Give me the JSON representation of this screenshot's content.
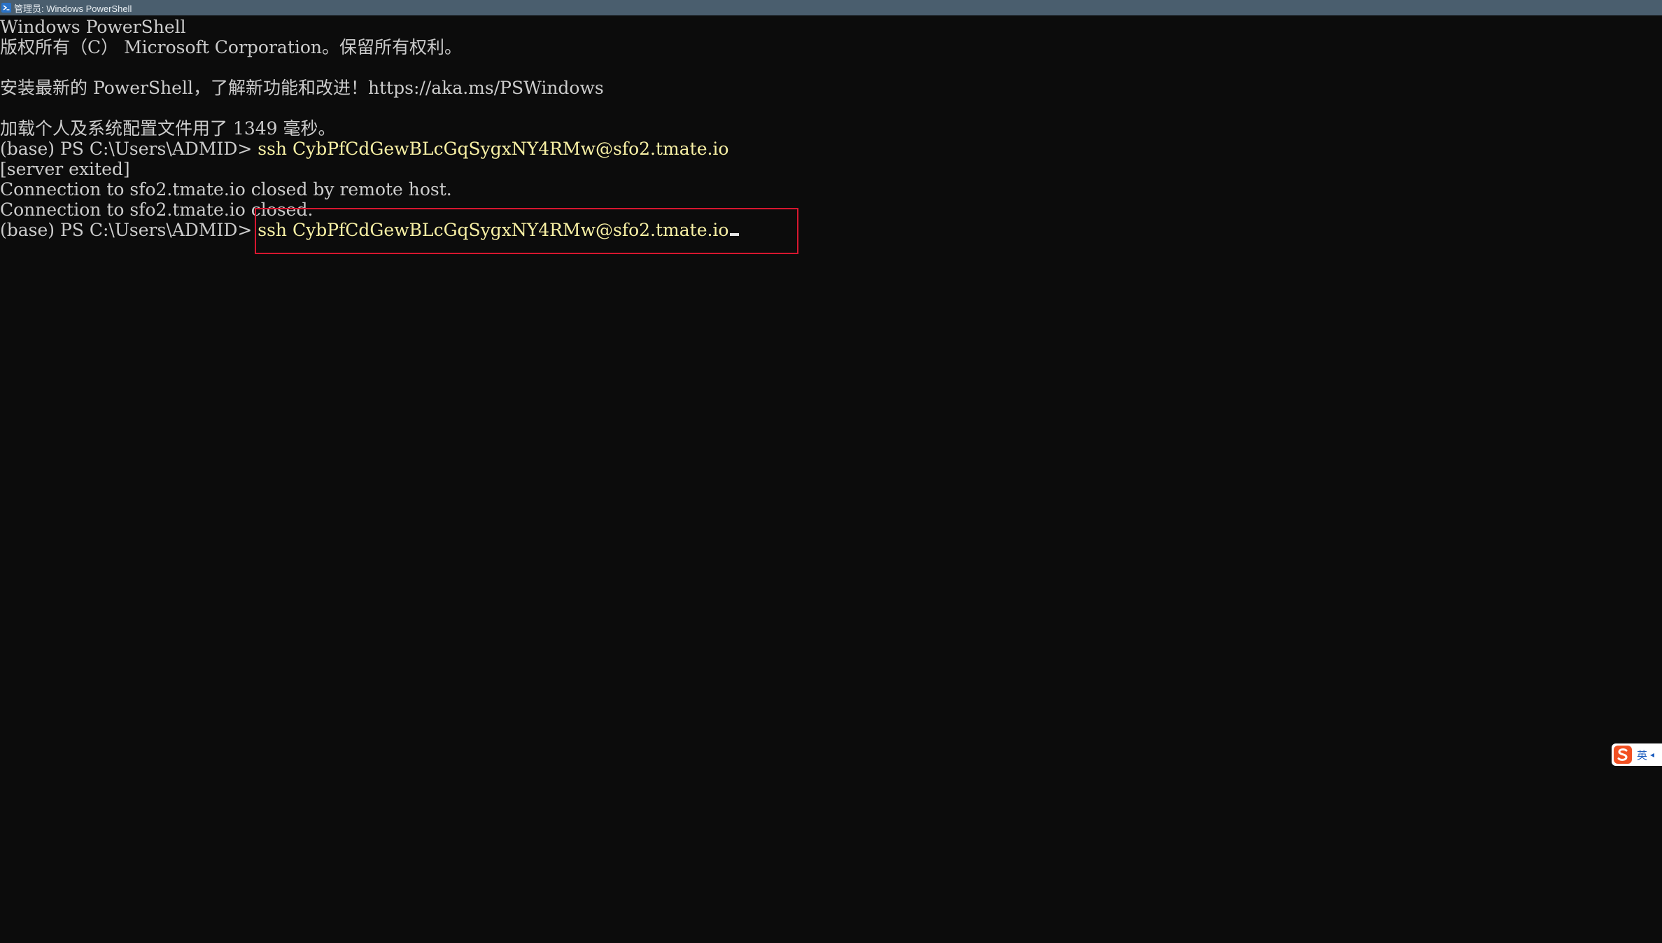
{
  "window": {
    "title": "管理员: Windows PowerShell"
  },
  "terminal": {
    "lines": [
      "Windows PowerShell",
      "版权所有（C） Microsoft Corporation。保留所有权利。",
      "",
      "安装最新的 PowerShell，了解新功能和改进！https://aka.ms/PSWindows",
      "",
      "加载个人及系统配置文件用了 1349 毫秒。"
    ],
    "prompt1": "(base) PS C:\\Users\\ADMID> ",
    "command1": "ssh CybPfCdGewBLcGqSygxNY4RMw@sfo2.tmate.io",
    "output": [
      "[server exited]",
      "Connection to sfo2.tmate.io closed by remote host.",
      "Connection to sfo2.tmate.io closed."
    ],
    "prompt2": "(base) PS C:\\Users\\ADMID> ",
    "command2": "ssh CybPfCdGewBLcGqSygxNY4RMw@sfo2.tmate.io"
  },
  "ime": {
    "mode": "英",
    "logo_icon": "sogou-logo-icon",
    "arrow_icon": "arrow-icon"
  },
  "colors": {
    "background": "#0c0c0c",
    "text": "#cccccc",
    "command": "#f9f1a5",
    "highlight": "#d7172f",
    "titlebar": "#4a5e6e"
  }
}
